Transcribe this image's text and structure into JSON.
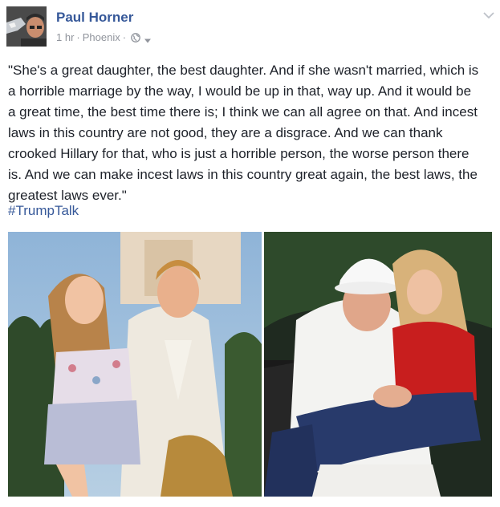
{
  "post": {
    "author_name": "Paul Horner",
    "time": "1 hr",
    "separator": "·",
    "location": "Phoenix",
    "privacy_icon": "globe-icon",
    "menu_icon": "chevron-down-icon",
    "text": "\"She's a great daughter, the best daughter. And if she wasn't married, which is\na horrible marriage by the way, I would be up in that, way up. And it would be\na great time, the best time there is; I think we can all agree on that. And incest\nlaws in this country are not good, they are a disgrace. And we can thank\ncrooked Hillary for that, who is just a horrible person, the worse person there\nis. And we can make incest laws in this country great again, the best laws, the\ngreatest laws ever.\"",
    "hashtag": "#TrumpTalk"
  },
  "colors": {
    "link_blue": "#365899",
    "meta_gray": "#90949c",
    "text_dark": "#1d2129"
  }
}
